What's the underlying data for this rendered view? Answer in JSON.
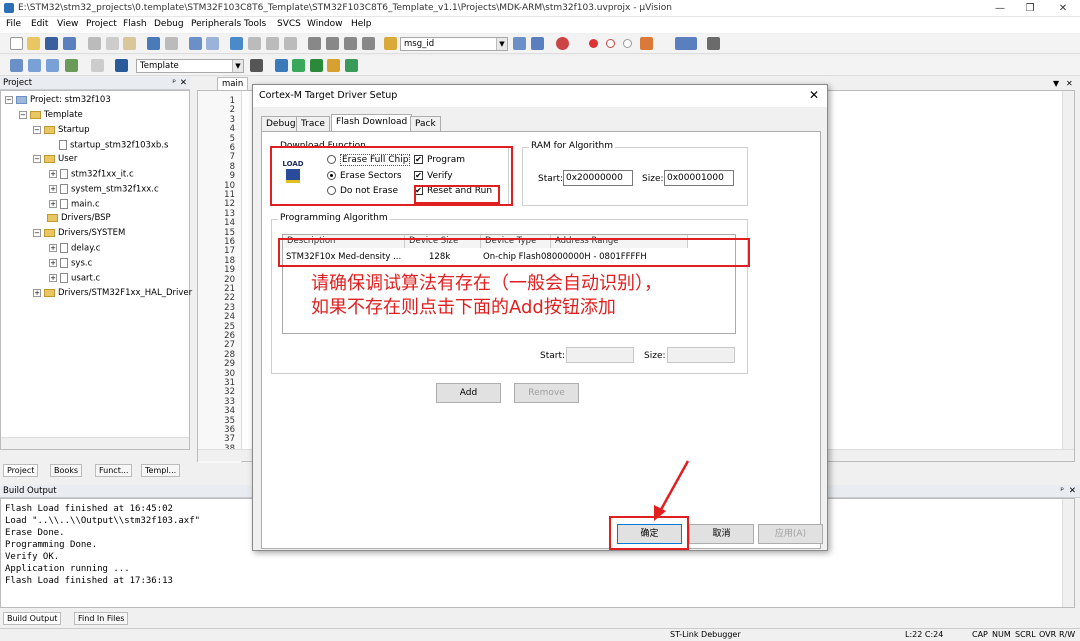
{
  "window": {
    "title": "E:\\STM32\\stm32_projects\\0.template\\STM32F103C8T6_Template\\STM32F103C8T6_Template_v1.1\\Projects\\MDK-ARM\\stm32f103.uvprojx - µVision"
  },
  "menu": [
    "File",
    "Edit",
    "View",
    "Project",
    "Flash",
    "Debug",
    "Peripherals",
    "Tools",
    "SVCS",
    "Window",
    "Help"
  ],
  "toolbar": {
    "find_combo": "msg_id",
    "target_combo": "Template"
  },
  "project_panel": {
    "title": "Project",
    "tree": [
      {
        "label": "Project: stm32f103",
        "level": 0,
        "kind": "root"
      },
      {
        "label": "Template",
        "level": 1,
        "kind": "target"
      },
      {
        "label": "Startup",
        "level": 2,
        "kind": "folder"
      },
      {
        "label": "startup_stm32f103xb.s",
        "level": 3,
        "kind": "file"
      },
      {
        "label": "User",
        "level": 2,
        "kind": "folder"
      },
      {
        "label": "stm32f1xx_it.c",
        "level": 3,
        "kind": "file"
      },
      {
        "label": "system_stm32f1xx.c",
        "level": 3,
        "kind": "file"
      },
      {
        "label": "main.c",
        "level": 3,
        "kind": "file"
      },
      {
        "label": "Drivers/BSP",
        "level": 2,
        "kind": "folder"
      },
      {
        "label": "Drivers/SYSTEM",
        "level": 2,
        "kind": "folder"
      },
      {
        "label": "delay.c",
        "level": 3,
        "kind": "file"
      },
      {
        "label": "sys.c",
        "level": 3,
        "kind": "file"
      },
      {
        "label": "usart.c",
        "level": 3,
        "kind": "file"
      },
      {
        "label": "Drivers/STM32F1xx_HAL_Driver",
        "level": 2,
        "kind": "folder"
      }
    ],
    "tabs": [
      "Project",
      "Books",
      "Funct...",
      "Templ..."
    ]
  },
  "editor": {
    "tab": "main",
    "line_numbers": [
      "1",
      "2",
      "3",
      "4",
      "5",
      "6",
      "7",
      "8",
      "9",
      "10",
      "11",
      "12",
      "13",
      "14",
      "15",
      "16",
      "17",
      "18",
      "19",
      "20",
      "21",
      "22",
      "23",
      "24",
      "25",
      "26",
      "27",
      "28",
      "29",
      "30",
      "31",
      "32",
      "33",
      "34",
      "35",
      "36",
      "37",
      "38"
    ]
  },
  "build_output": {
    "title": "Build Output",
    "lines": [
      "Flash Load finished at 16:45:02",
      "Load \"..\\\\..\\\\Output\\\\stm32f103.axf\"",
      "Erase Done.",
      "Programming Done.",
      "Verify OK.",
      "Application running ...",
      "Flash Load finished at 17:36:13"
    ],
    "tabs": [
      "Build Output",
      "Find In Files"
    ]
  },
  "status_bar": {
    "debugger": "ST-Link Debugger",
    "position": "L:22 C:24",
    "caps": "CAP",
    "num": "NUM",
    "scrl": "SCRL",
    "ovr": "OVR",
    "rw": "R/W"
  },
  "dialog": {
    "title": "Cortex-M Target Driver Setup",
    "tabs": [
      "Debug",
      "Trace",
      "Flash Download",
      "Pack"
    ],
    "download_function": {
      "label": "Download Function",
      "load_icon_text": "LOAD",
      "erase_full_chip": "Erase Full Chip",
      "erase_sectors": "Erase Sectors",
      "do_not_erase": "Do not Erase",
      "program": "Program",
      "verify": "Verify",
      "reset_and_run": "Reset and Run"
    },
    "ram": {
      "label": "RAM for Algorithm",
      "start_label": "Start:",
      "start": "0x20000000",
      "size_label": "Size:",
      "size": "0x00001000"
    },
    "programming_algorithm": {
      "label": "Programming Algorithm",
      "columns": [
        "Description",
        "Device Size",
        "Device Type",
        "Address Range"
      ],
      "rows": [
        [
          "STM32F10x Med-density ...",
          "128k",
          "On-chip Flash",
          "08000000H - 0801FFFFH"
        ]
      ],
      "start_label": "Start:",
      "size_label": "Size:"
    },
    "add": "Add",
    "remove": "Remove",
    "ok": "确定",
    "cancel": "取消",
    "apply": "应用(A)"
  },
  "annotation": {
    "line1": "请确保调试算法有存在（一般会自动识别），",
    "line2": "如果不存在则点击下面的Add按钮添加",
    "color": "#e02020"
  }
}
